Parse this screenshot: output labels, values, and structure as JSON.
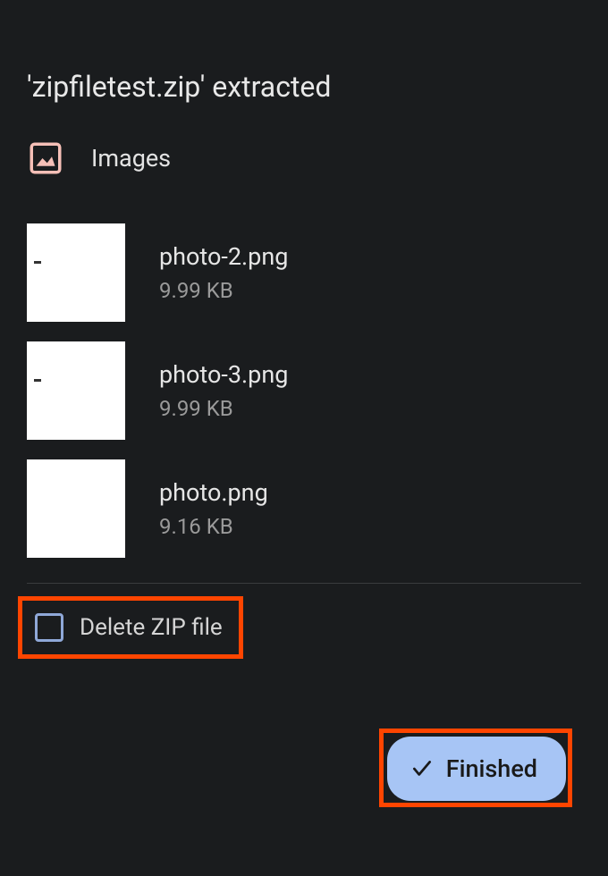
{
  "title": "'zipfiletest.zip' extracted",
  "section": {
    "label": "Images",
    "icon": "image-icon"
  },
  "files": [
    {
      "name": "photo-2.png",
      "size": "9.99 KB"
    },
    {
      "name": "photo-3.png",
      "size": "9.99 KB"
    },
    {
      "name": "photo.png",
      "size": "9.16 KB"
    }
  ],
  "checkbox": {
    "label": "Delete ZIP file",
    "checked": false
  },
  "button": {
    "label": "Finished",
    "icon": "check-icon"
  },
  "highlights": {
    "checkbox": true,
    "button": true
  },
  "colors": {
    "highlight": "#ff4500",
    "button_bg": "#a7c5f5",
    "icon_tint": "#f5bfb7"
  }
}
